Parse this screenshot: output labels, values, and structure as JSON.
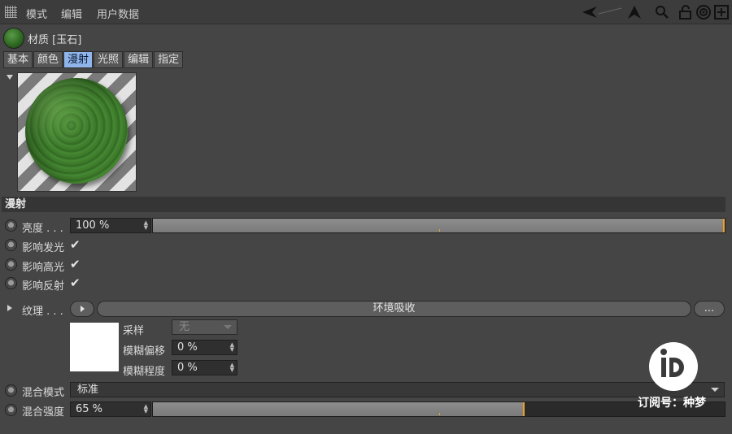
{
  "menubar": {
    "items": [
      "模式",
      "编辑",
      "用户数据"
    ],
    "tools": [
      "back-arrow-icon",
      "forward-arrow-icon",
      "up-arrow-icon",
      "search-icon",
      "lock-icon",
      "target-icon",
      "new-window-icon"
    ]
  },
  "material": {
    "title": "材质 [玉石]"
  },
  "tabs": [
    {
      "label": "基本",
      "active": false
    },
    {
      "label": "颜色",
      "active": false
    },
    {
      "label": "漫射",
      "active": true
    },
    {
      "label": "光照",
      "active": false
    },
    {
      "label": "编辑",
      "active": false
    },
    {
      "label": "指定",
      "active": false
    }
  ],
  "section": {
    "title": "漫射"
  },
  "brightness": {
    "label": "亮度 . . .",
    "value": "100 %",
    "fraction": 1.0
  },
  "checks": [
    {
      "label": "影响发光",
      "checked": true,
      "mark": "✔"
    },
    {
      "label": "影响高光",
      "checked": true,
      "mark": "✔"
    },
    {
      "label": "影响反射",
      "checked": true,
      "mark": "✔"
    }
  ],
  "texture": {
    "label": "纹理 . . .",
    "shader_name": "环境吸收",
    "more_label": "...",
    "sampling_label": "采样",
    "sampling_value": "无",
    "blur_offset_label": "模糊偏移",
    "blur_offset_value": "0 %",
    "blur_scale_label": "模糊程度",
    "blur_scale_value": "0 %"
  },
  "blend_mode": {
    "label": "混合模式",
    "value": "标准"
  },
  "blend_strength": {
    "label": "混合强度",
    "value": "65 %",
    "fraction": 0.65
  },
  "watermark": {
    "text": "订阅号：种梦"
  },
  "colors": {
    "accent": "#f0a020",
    "active_tab": "#8fb5ea",
    "background": "#454545"
  }
}
